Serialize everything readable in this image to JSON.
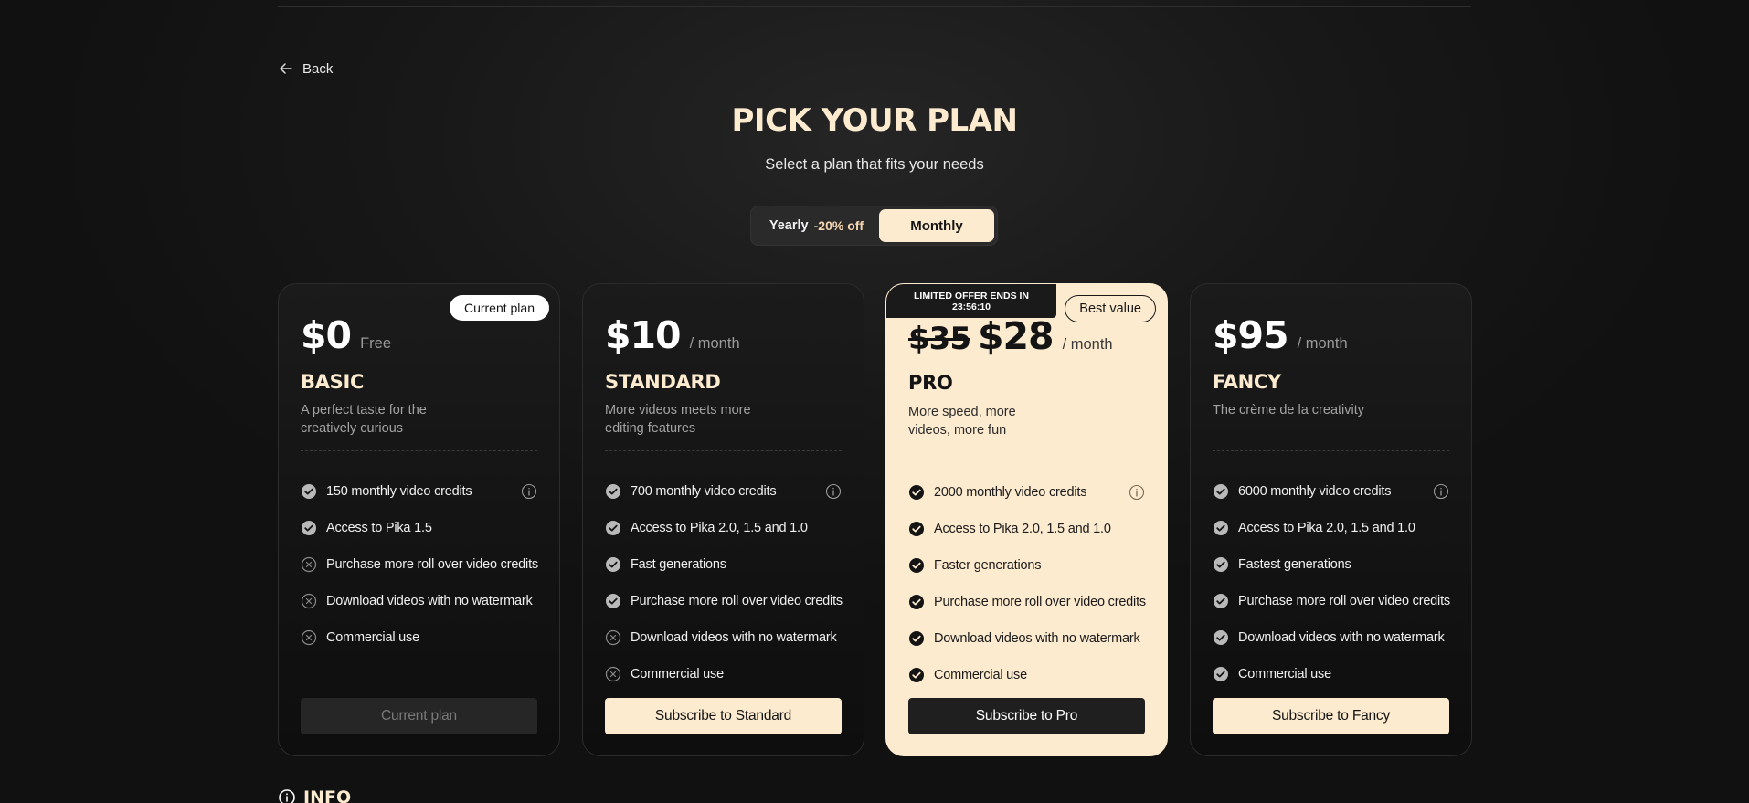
{
  "nav": {
    "back_label": "Back"
  },
  "header": {
    "title": "PICK YOUR PLAN",
    "subtitle": "Select a plan that fits your needs"
  },
  "billing_toggle": {
    "yearly_label": "Yearly",
    "yearly_discount": "-20% off",
    "monthly_label": "Monthly",
    "selected": "Monthly"
  },
  "plans": [
    {
      "price": "$0",
      "period": "Free",
      "name": "BASIC",
      "description": "A perfect taste for the creatively curious",
      "badge": "Current plan",
      "features": [
        {
          "text": "150 monthly video credits",
          "included": true,
          "info_icon": true
        },
        {
          "text": "Access to Pika 1.5",
          "included": true
        },
        {
          "text": "Purchase more roll over video credits",
          "included": false
        },
        {
          "text": "Download videos with no watermark",
          "included": false
        },
        {
          "text": "Commercial use",
          "included": false
        }
      ],
      "cta": "Current plan"
    },
    {
      "price": "$10",
      "period": "/ month",
      "name": "STANDARD",
      "description": "More videos meets more editing features",
      "features": [
        {
          "text": "700 monthly video credits",
          "included": true,
          "info_icon": true
        },
        {
          "text": "Access to Pika 2.0, 1.5 and 1.0",
          "included": true
        },
        {
          "text": "Fast generations",
          "included": true
        },
        {
          "text": "Purchase more roll over video credits",
          "included": true
        },
        {
          "text": "Download videos with no watermark",
          "included": false
        },
        {
          "text": "Commercial use",
          "included": false
        }
      ],
      "cta": "Subscribe to Standard"
    },
    {
      "old_price": "$35",
      "price": "$28",
      "period": "/ month",
      "name": "PRO",
      "description": "More speed, more videos, more fun",
      "offer_line1": "LIMITED OFFER ENDS IN",
      "offer_timer": "23:56:10",
      "badge": "Best value",
      "features": [
        {
          "text": "2000 monthly video credits",
          "included": true,
          "info_icon": true
        },
        {
          "text": "Access to Pika 2.0, 1.5 and 1.0",
          "included": true
        },
        {
          "text": "Faster generations",
          "included": true
        },
        {
          "text": "Purchase more roll over video credits",
          "included": true
        },
        {
          "text": "Download videos with no watermark",
          "included": true
        },
        {
          "text": "Commercial use",
          "included": true
        }
      ],
      "cta": "Subscribe to Pro"
    },
    {
      "price": "$95",
      "period": "/ month",
      "name": "FANCY",
      "description": "The crème de la creativity",
      "features": [
        {
          "text": "6000 monthly video credits",
          "included": true,
          "info_icon": true
        },
        {
          "text": "Access to Pika 2.0, 1.5 and 1.0",
          "included": true
        },
        {
          "text": "Fastest generations",
          "included": true
        },
        {
          "text": "Purchase more roll over video credits",
          "included": true
        },
        {
          "text": "Download videos with no watermark",
          "included": true
        },
        {
          "text": "Commercial use",
          "included": true
        }
      ],
      "cta": "Subscribe to Fancy"
    }
  ],
  "footer_section": {
    "title": "INFO"
  },
  "colors": {
    "accent": "#fdebd0",
    "background": "#141414",
    "pro_card": "#fdebd0"
  }
}
